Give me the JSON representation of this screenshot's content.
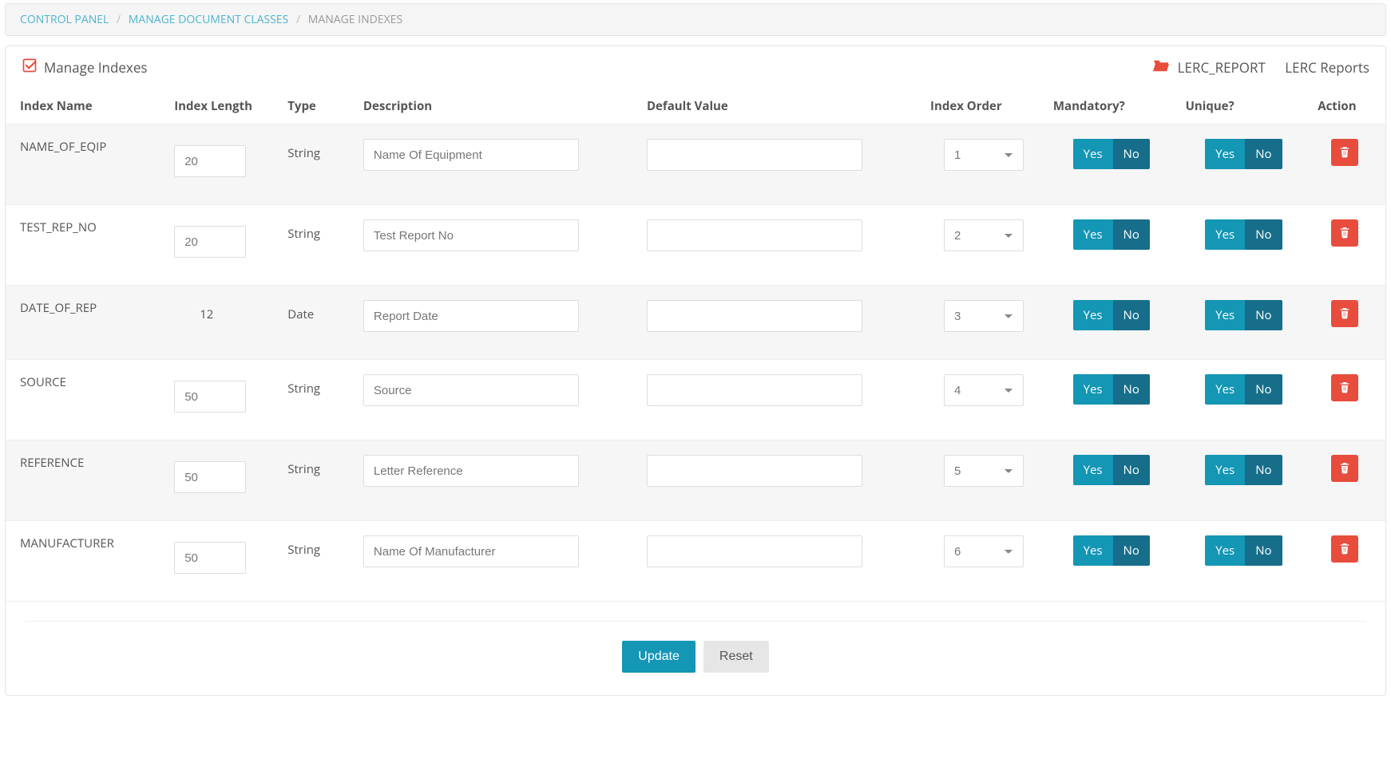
{
  "breadcrumb": {
    "items": [
      "CONTROL PANEL",
      "MANAGE DOCUMENT CLASSES",
      "MANAGE INDEXES"
    ]
  },
  "panel": {
    "title": "Manage Indexes",
    "class_code": "LERC_REPORT",
    "class_label": "LERC Reports"
  },
  "columns": {
    "name": "Index Name",
    "length": "Index Length",
    "type": "Type",
    "description": "Description",
    "default": "Default Value",
    "order": "Index Order",
    "mandatory": "Mandatory?",
    "unique": "Unique?",
    "action": "Action"
  },
  "labels": {
    "yes": "Yes",
    "no": "No",
    "update": "Update",
    "reset": "Reset"
  },
  "rows": [
    {
      "name": "NAME_OF_EQIP",
      "length": "20",
      "length_editable": true,
      "type": "String",
      "description": "Name Of Equipment",
      "default_value": "",
      "order": "1"
    },
    {
      "name": "TEST_REP_NO",
      "length": "20",
      "length_editable": true,
      "type": "String",
      "description": "Test Report No",
      "default_value": "",
      "order": "2"
    },
    {
      "name": "DATE_OF_REP",
      "length": "12",
      "length_editable": false,
      "type": "Date",
      "description": "Report Date",
      "default_value": "",
      "order": "3"
    },
    {
      "name": "SOURCE",
      "length": "50",
      "length_editable": true,
      "type": "String",
      "description": "Source",
      "default_value": "",
      "order": "4"
    },
    {
      "name": "REFERENCE",
      "length": "50",
      "length_editable": true,
      "type": "String",
      "description": "Letter Reference",
      "default_value": "",
      "order": "5"
    },
    {
      "name": "MANUFACTURER",
      "length": "50",
      "length_editable": true,
      "type": "String",
      "description": "Name Of Manufacturer",
      "default_value": "",
      "order": "6"
    }
  ]
}
